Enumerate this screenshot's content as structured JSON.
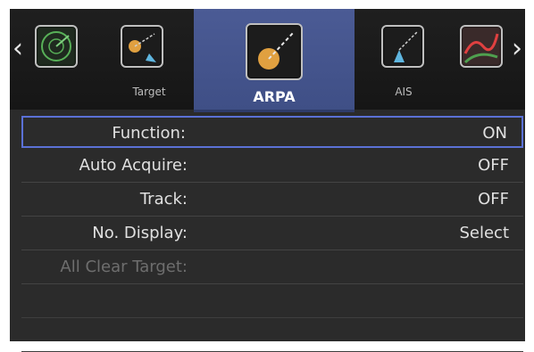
{
  "tabs": [
    {
      "name": "radar",
      "label": "",
      "icon": "radar-scope-icon",
      "active": false
    },
    {
      "name": "target",
      "label": "Target",
      "icon": "target-icon",
      "active": false
    },
    {
      "name": "arpa",
      "label": "ARPA",
      "icon": "arpa-icon",
      "active": true
    },
    {
      "name": "ais",
      "label": "AIS",
      "icon": "ais-icon",
      "active": false
    },
    {
      "name": "chart",
      "label": "",
      "icon": "chart-overlay-icon",
      "active": false
    }
  ],
  "nav": {
    "prev": "‹",
    "next": "›"
  },
  "menu": {
    "rows": [
      {
        "label": "Function:",
        "value": "ON"
      },
      {
        "label": "Auto Acquire:",
        "value": "OFF"
      },
      {
        "label": "Track:",
        "value": "OFF"
      },
      {
        "label": "No. Display:",
        "value": "Select"
      },
      {
        "label": "All Clear Target:",
        "value": ""
      }
    ]
  },
  "colors": {
    "active_tab": "#4b5b95",
    "selection": "#5b71d6",
    "background": "#2b2b2b"
  }
}
